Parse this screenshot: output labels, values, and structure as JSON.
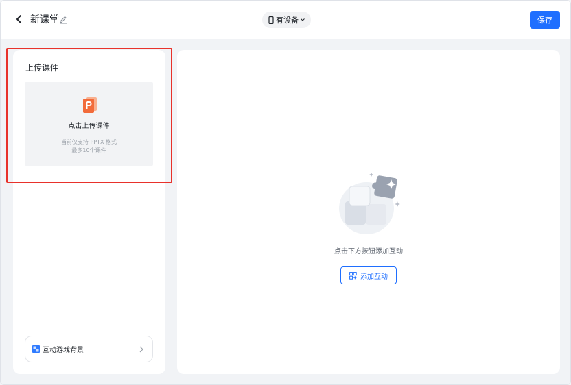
{
  "header": {
    "title": "新课堂",
    "device_label": "有设备",
    "save_label": "保存"
  },
  "left_panel": {
    "section_title": "上传课件",
    "upload": {
      "label": "点击上传课件",
      "hint_line1": "当前仅支持 PPTX 格式",
      "hint_line2": "最多10个课件"
    },
    "background_row": {
      "label": "互动游戏背景"
    }
  },
  "right_panel": {
    "empty_text": "点击下方按钮添加互动",
    "add_button_label": "添加互动"
  },
  "colors": {
    "accent": "#1f6fff",
    "highlight": "#e8322b",
    "ppt_orange": "#f26b3a"
  },
  "icons": {
    "back": "chevron-left-icon",
    "edit": "pencil-icon",
    "device": "phone-icon",
    "dropdown": "chevron-down-icon",
    "ppt": "ppt-file-icon",
    "background": "grid-icon",
    "chevron_right": "chevron-right-icon",
    "add": "grid-add-icon",
    "illustration": "puzzle-illustration"
  }
}
